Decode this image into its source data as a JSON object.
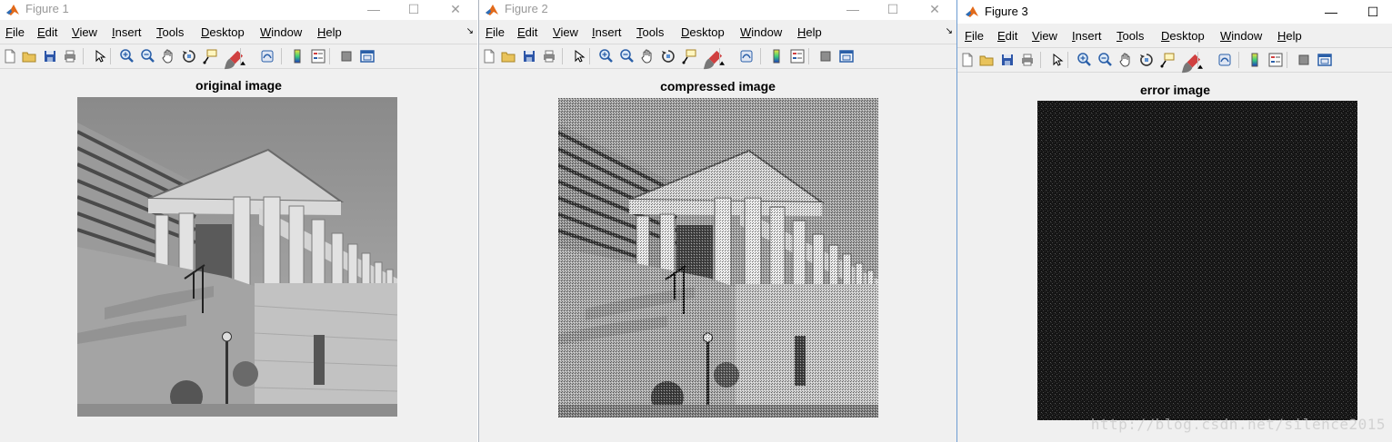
{
  "windows": [
    {
      "title": "Figure 1",
      "axes_title": "original image",
      "active": false
    },
    {
      "title": "Figure 2",
      "axes_title": "compressed image",
      "active": false
    },
    {
      "title": "Figure 3",
      "axes_title": "error image",
      "active": true
    }
  ],
  "menu": [
    {
      "label": "File",
      "key": "F",
      "rest": "ile"
    },
    {
      "label": "Edit",
      "key": "E",
      "rest": "dit"
    },
    {
      "label": "View",
      "key": "V",
      "rest": "iew"
    },
    {
      "label": "Insert",
      "key": "I",
      "rest": "nsert"
    },
    {
      "label": "Tools",
      "key": "T",
      "rest": "ools"
    },
    {
      "label": "Desktop",
      "key": "D",
      "rest": "esktop"
    },
    {
      "label": "Window",
      "key": "W",
      "rest": "indow"
    },
    {
      "label": "Help",
      "key": "H",
      "rest": "elp"
    }
  ],
  "toolbar_icons": [
    "new-figure-icon",
    "open-file-icon",
    "save-icon",
    "print-icon",
    "edit-plot-icon",
    "zoom-in-icon",
    "zoom-out-icon",
    "pan-icon",
    "rotate-3d-icon",
    "data-cursor-icon",
    "brush-icon",
    "link-plot-icon",
    "colorbar-icon",
    "legend-icon",
    "hide-plot-tools-icon",
    "show-plot-tools-icon"
  ],
  "window_controls": {
    "minimize": "—",
    "maximize": "☐",
    "close": "✕"
  },
  "dock_glyph": "↘",
  "watermark": "http://blog.csdn.net/silence2015",
  "colors": {
    "window_bg": "#f0f0f0",
    "inactive_title": "#999999",
    "error_image_bg": "#161616"
  }
}
